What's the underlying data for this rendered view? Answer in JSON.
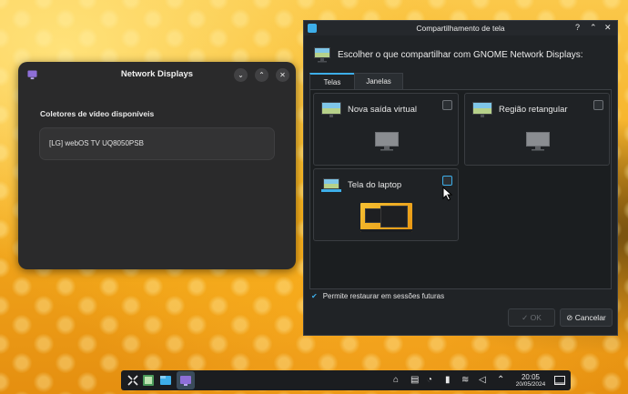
{
  "network_displays": {
    "title": "Network Displays",
    "section_title": "Coletores de vídeo disponíveis",
    "sinks": [
      {
        "label": "[LG] webOS TV UQ8050PSB"
      }
    ]
  },
  "share_dialog": {
    "title": "Compartilhamento de tela",
    "heading": "Escolher o que compartilhar com GNOME Network Displays:",
    "tabs": [
      {
        "label": "Telas",
        "active": true
      },
      {
        "label": "Janelas",
        "active": false
      }
    ],
    "sources": [
      {
        "label": "Nova saída virtual",
        "checked": false
      },
      {
        "label": "Região retangular",
        "checked": false
      },
      {
        "label": "Tela do laptop",
        "checked": false
      }
    ],
    "restore_label": "Permite restaurar em sessões futuras",
    "restore_checked": true,
    "ok_label": "OK",
    "cancel_label": "Cancelar"
  },
  "taskbar": {
    "time": "20:05",
    "date": "20/05/2024"
  },
  "icons": {
    "app_launcher": "app-launcher-icon",
    "tray": [
      "chat-icon",
      "clipboard-icon",
      "vault-icon",
      "volume-device-icon",
      "wifi-icon",
      "volume-icon",
      "chevron-up-icon",
      "show-desktop-icon"
    ]
  },
  "colors": {
    "accent": "#3daee9",
    "dialog_bg": "#202326",
    "gnome_window_bg": "#2a2a2b"
  }
}
